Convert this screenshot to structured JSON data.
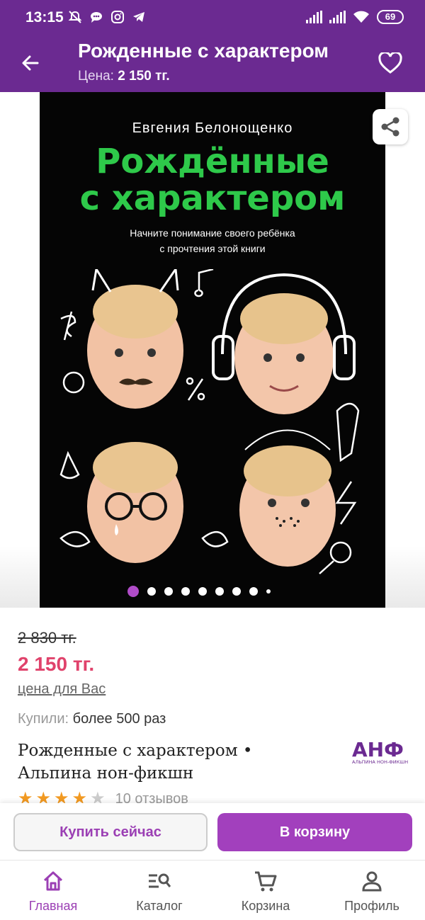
{
  "status_bar": {
    "time": "13:15",
    "battery": "69",
    "left_icons": [
      "mute-icon",
      "chat-icon",
      "instagram-icon",
      "telegram-icon"
    ],
    "right_icons": [
      "signal-icon",
      "signal-icon",
      "wifi-icon",
      "battery-icon"
    ]
  },
  "header": {
    "title": "Рожденные с характером",
    "price_label": "Цена:",
    "price_value": "2 150 тг."
  },
  "cover": {
    "author": "Евгения Белонощенко",
    "title_line1": "Рождённые",
    "title_line2": "с характером",
    "tagline_line1": "Начните понимание своего ребёнка",
    "tagline_line2": "с прочтения этой книги"
  },
  "carousel": {
    "total": 9,
    "active_index": 0
  },
  "product": {
    "old_price": "2 830 тг.",
    "price": "2 150 тг.",
    "price_note": "цена для Вас",
    "bought_label": "Купили:",
    "bought_value": "более 500 раз",
    "name": "Рожденные с характером • Альпина нон-фикшн",
    "publisher_logo_text": "АНФ",
    "publisher_logo_sub": "АЛЬПИНА НОН-ФИКШН",
    "rating": 4,
    "rating_max": 5,
    "reviews": "10 отзывов"
  },
  "actions": {
    "buy_now": "Купить сейчас",
    "add_to_cart": "В корзину"
  },
  "nav": [
    {
      "label": "Главная",
      "icon": "home-icon",
      "active": true
    },
    {
      "label": "Каталог",
      "icon": "catalog-search-icon",
      "active": false
    },
    {
      "label": "Корзина",
      "icon": "cart-icon",
      "active": false
    },
    {
      "label": "Профиль",
      "icon": "profile-icon",
      "active": false
    }
  ],
  "colors": {
    "brand": "#6b2a91",
    "accent": "#a240bd",
    "price": "#e0426b",
    "cover_title": "#2ec94a",
    "star": "#f29a22"
  }
}
